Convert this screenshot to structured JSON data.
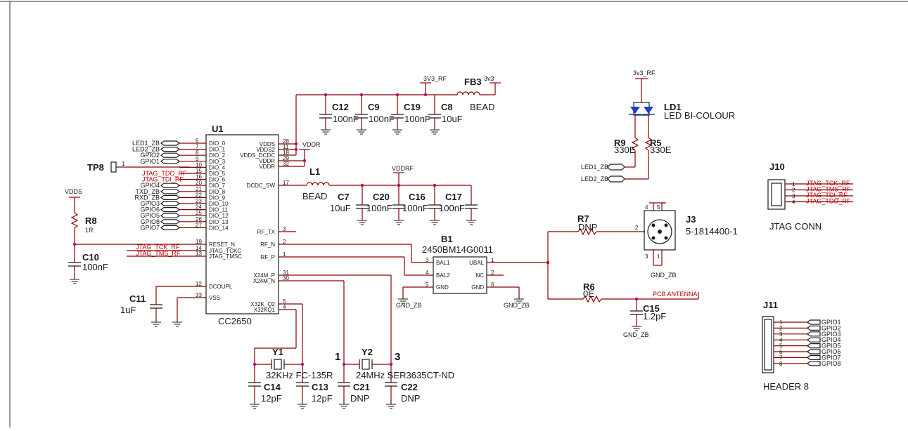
{
  "u1": {
    "ref": "U1",
    "part": "CC2650",
    "left_pins": [
      {
        "num": "6",
        "name": "DIO_0"
      },
      {
        "num": "7",
        "name": "DIO_1"
      },
      {
        "num": "8",
        "name": "DIO_2"
      },
      {
        "num": "9",
        "name": "DIO_3"
      },
      {
        "num": "10",
        "name": "DIO_4"
      },
      {
        "num": "15",
        "name": "DIO_5"
      },
      {
        "num": "16",
        "name": "DIO_6"
      },
      {
        "num": "20",
        "name": "DIO_7"
      },
      {
        "num": "21",
        "name": "DIO_8"
      },
      {
        "num": "22",
        "name": "DIO_9"
      },
      {
        "num": "23",
        "name": "DIO_10"
      },
      {
        "num": "24",
        "name": "DIO_11"
      },
      {
        "num": "25",
        "name": "DIO_12"
      },
      {
        "num": "26",
        "name": "DIO_13"
      },
      {
        "num": "27",
        "name": "DIO_14"
      }
    ],
    "right_pins": [
      {
        "num": "28",
        "name": "VDDS"
      },
      {
        "num": "11",
        "name": "VDDS2"
      },
      {
        "num": "18",
        "name": "VDDS_DCDC"
      },
      {
        "num": "29",
        "name": "VDDR"
      },
      {
        "num": "32",
        "name": "VDDR"
      },
      {
        "num": "17",
        "name": "DCDC_SW"
      },
      {
        "num": "3",
        "name": "RF_TX"
      },
      {
        "num": "2",
        "name": "RF_N"
      },
      {
        "num": "1",
        "name": "RF_P"
      },
      {
        "num": "31",
        "name": "X24M_P"
      },
      {
        "num": "30",
        "name": "X24M_N"
      },
      {
        "num": "5",
        "name": "X32K_Q2"
      },
      {
        "num": "4",
        "name": "X32KQ1"
      }
    ],
    "bottom_left_pins": [
      {
        "num": "19",
        "name": "RESET_N"
      },
      {
        "num": "14",
        "name": "JTAG_TCKC"
      },
      {
        "num": "13",
        "name": "JTAG_TMSC"
      },
      {
        "num": "12",
        "name": "DCOUPL"
      },
      {
        "num": "33",
        "name": "VSS"
      }
    ]
  },
  "left_nets": [
    "LED1_ZB",
    "LED2_ZB",
    "GPIO2",
    "GPIO1",
    "",
    "JTAG_TDO_RF",
    "JTAG_TDI_RF",
    "GPIO4",
    "TXD_ZB",
    "RXD_ZB",
    "GPIO3",
    "GPIO6",
    "GPIO5",
    "GPIO8",
    "GPIO7"
  ],
  "jtag_nets": [
    "JTAG_TCK_RF",
    "JTAG_TMS_RF"
  ],
  "tp8": {
    "ref": "TP8",
    "pin": "1"
  },
  "supply": {
    "vdds": "VDDS",
    "vddr": "VDDR",
    "vddrf": "VDDRF",
    "v3v3_rf": "3V3_RF",
    "v3v3": "3v3",
    "v3v3_rf_led": "3v3_RF"
  },
  "fb3": {
    "ref": "FB3",
    "value": "BEAD"
  },
  "l1": {
    "ref": "L1",
    "value": "BEAD"
  },
  "caps_top": [
    {
      "ref": "C12",
      "value": "100nF"
    },
    {
      "ref": "C9",
      "value": "100nF"
    },
    {
      "ref": "C19",
      "value": "100nF"
    },
    {
      "ref": "C8",
      "value": "10uF"
    }
  ],
  "caps_mid": [
    {
      "ref": "C7",
      "value": "10uF"
    },
    {
      "ref": "C20",
      "value": "100nF"
    },
    {
      "ref": "C16",
      "value": "100nF"
    },
    {
      "ref": "C17",
      "value": "100nF"
    }
  ],
  "r8": {
    "ref": "R8",
    "value": "1R"
  },
  "c10": {
    "ref": "C10",
    "value": "100nF"
  },
  "c11": {
    "ref": "C11",
    "value": "1uF"
  },
  "b1": {
    "ref": "B1",
    "part": "2450BM14G0011",
    "pins": [
      {
        "num": "3",
        "name": "BAL1"
      },
      {
        "num": "4",
        "name": "BAL2"
      },
      {
        "num": "5",
        "name": "GND"
      },
      {
        "num": "1",
        "name": "UBAL"
      },
      {
        "num": "2",
        "name": "NC"
      },
      {
        "num": "6",
        "name": "GND"
      }
    ]
  },
  "gnd_zb": "GND_ZB",
  "r7": {
    "ref": "R7",
    "value": "DNP"
  },
  "r6": {
    "ref": "R6",
    "value": "0E"
  },
  "c15": {
    "ref": "C15",
    "value": "1.2pF"
  },
  "pcb_antenna": "PCB ANTENNA",
  "j3": {
    "ref": "J3",
    "part": "5-1814400-1",
    "pins": [
      "1",
      "2",
      "3",
      "4",
      "5"
    ]
  },
  "ld1": {
    "ref": "LD1",
    "value": "LED BI-COLOUR"
  },
  "r9": {
    "ref": "R9",
    "value": "330E"
  },
  "r5": {
    "ref": "R5",
    "value": "330E"
  },
  "led_nets": [
    "LED1_ZB",
    "LED2_ZB"
  ],
  "j10": {
    "ref": "J10",
    "label": "JTAG CONN",
    "pins": [
      {
        "num": "1",
        "net": "JTAG_TCK_RF"
      },
      {
        "num": "2",
        "net": "JTAG_TMS_RF"
      },
      {
        "num": "3",
        "net": "JTAG_TDI_RF"
      },
      {
        "num": "4",
        "net": "JTAG_TDO_RF"
      }
    ]
  },
  "j11": {
    "ref": "J11",
    "label": "HEADER 8",
    "pins": [
      {
        "num": "1",
        "net": "GPIO1"
      },
      {
        "num": "2",
        "net": "GPIO2"
      },
      {
        "num": "3",
        "net": "GPIO3"
      },
      {
        "num": "4",
        "net": "GPIO4"
      },
      {
        "num": "5",
        "net": "GPIO5"
      },
      {
        "num": "6",
        "net": "GPIO6"
      },
      {
        "num": "7",
        "net": "GPIO7"
      },
      {
        "num": "8",
        "net": "GPIO8"
      }
    ]
  },
  "y1": {
    "ref": "Y1",
    "value": "32KHz FC-135R"
  },
  "y2": {
    "ref": "Y2",
    "value": "24MHz SER3635CT-ND",
    "pin_left": "1",
    "pin_right": "3"
  },
  "c14": {
    "ref": "C14",
    "value": "12pF"
  },
  "c13": {
    "ref": "C13",
    "value": "12pF"
  },
  "c21": {
    "ref": "C21",
    "value": "DNP"
  },
  "c22": {
    "ref": "C22",
    "value": "DNP"
  }
}
